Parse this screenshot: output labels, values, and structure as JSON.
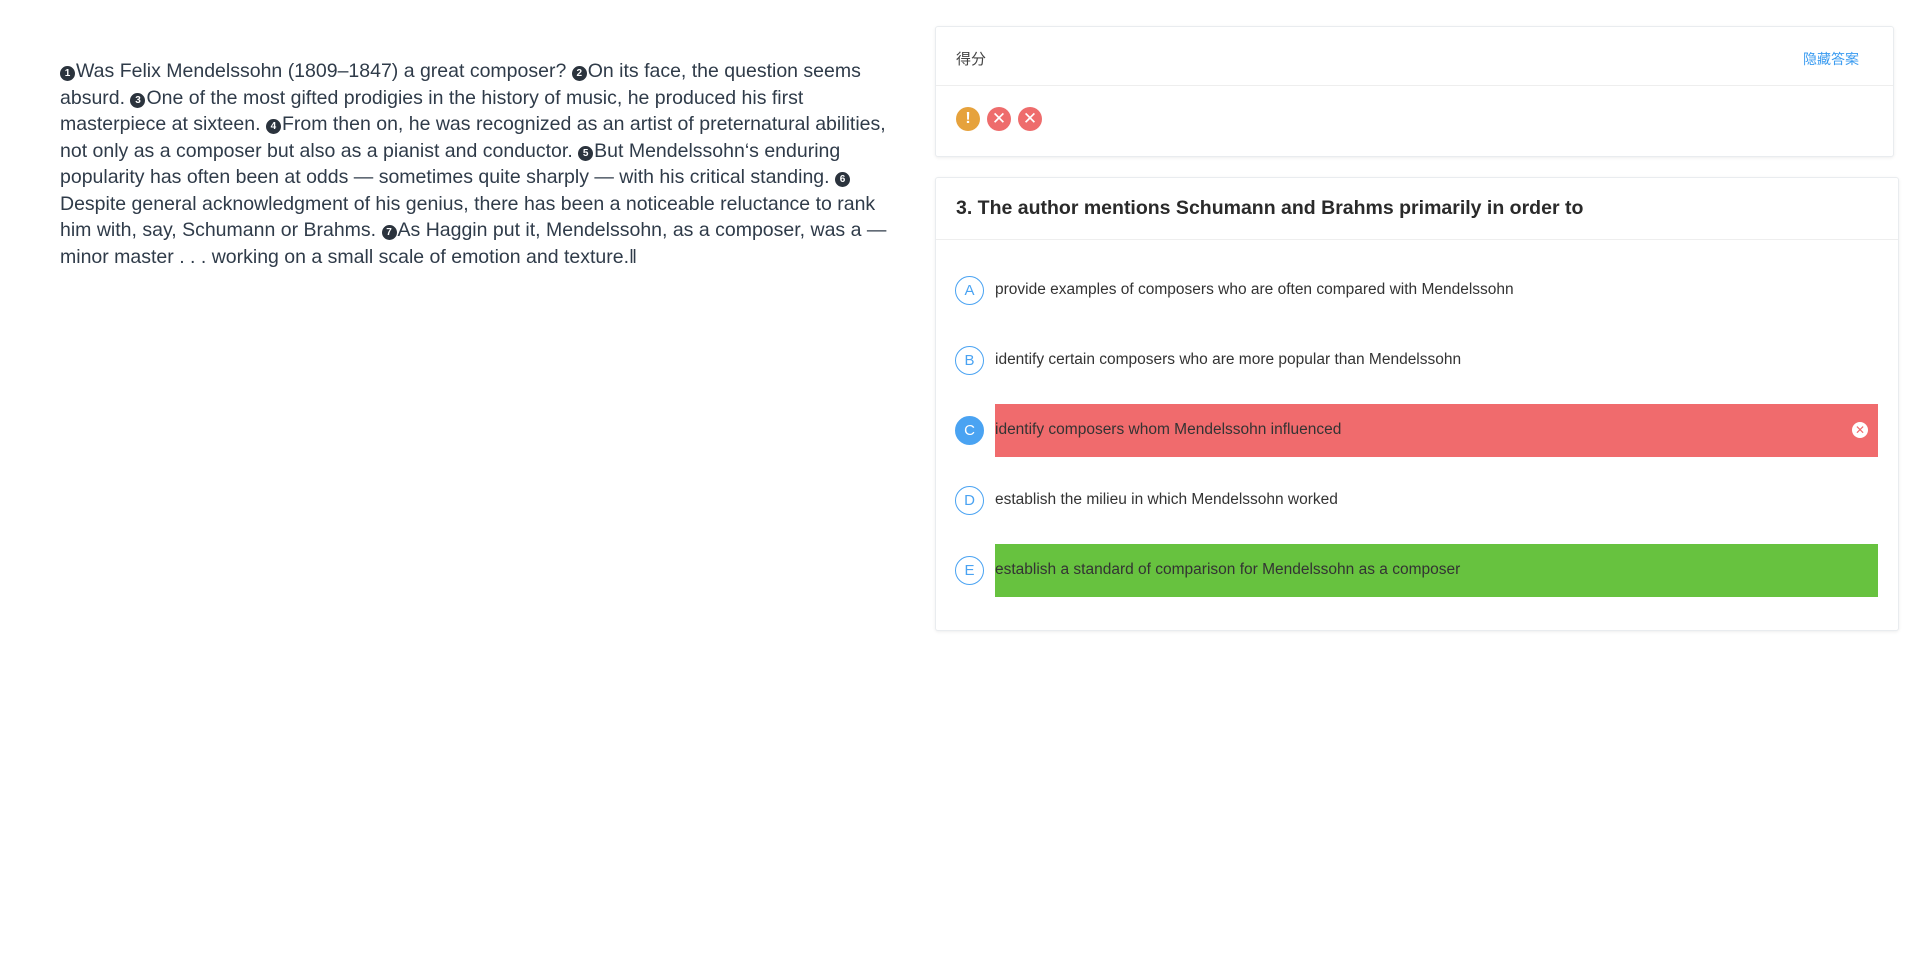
{
  "passage": {
    "sentences": [
      {
        "num": "1",
        "text": "Was Felix Mendelssohn (1809–1847) a great composer? "
      },
      {
        "num": "2",
        "text": "On its face, the question seems absurd. "
      },
      {
        "num": "3",
        "text": "One of the most gifted prodigies in the history of music, he produced his first masterpiece at sixteen. "
      },
      {
        "num": "4",
        "text": "From then on, he was recognized as an artist of preternatural abilities, not only as a composer but also as a pianist and conductor. "
      },
      {
        "num": "5",
        "text": "But Mendelssohn‘s enduring popularity has often been at odds — sometimes quite sharply — with his critical standing. "
      },
      {
        "num": "6",
        "text": "Despite general acknowledgment of his genius, there has been a noticeable reluctance to rank him with, say, Schumann or Brahms. "
      },
      {
        "num": "7",
        "text": "As Haggin put it, Mendelssohn, as a composer, was a —minor master . . . working on a small scale of emotion and texture.‖"
      }
    ]
  },
  "score": {
    "title": "得分",
    "toggle_label": "隐藏答案",
    "icons": [
      {
        "name": "warning-icon",
        "glyph": "!",
        "status": "warn"
      },
      {
        "name": "wrong-icon",
        "glyph": "✕",
        "status": "wrong"
      },
      {
        "name": "wrong-icon",
        "glyph": "✕",
        "status": "wrong"
      }
    ]
  },
  "question": {
    "title": "3. The author mentions Schumann and Brahms primarily in order to",
    "options": [
      {
        "letter": "A",
        "text": "provide examples of composers who are often compared with Mendelssohn",
        "state": "normal"
      },
      {
        "letter": "B",
        "text": "identify certain composers who are more popular than Mendelssohn",
        "state": "normal"
      },
      {
        "letter": "C",
        "text": "identify composers whom Mendelssohn influenced",
        "state": "wrong"
      },
      {
        "letter": "D",
        "text": "establish the milieu in which Mendelssohn worked",
        "state": "normal"
      },
      {
        "letter": "E",
        "text": "establish a standard of comparison for Mendelssohn as a composer",
        "state": "correct"
      }
    ]
  },
  "colors": {
    "accent": "#4aa3f2",
    "wrong": "#f06b6d",
    "correct": "#67c23f",
    "warning": "#e6a23c"
  }
}
